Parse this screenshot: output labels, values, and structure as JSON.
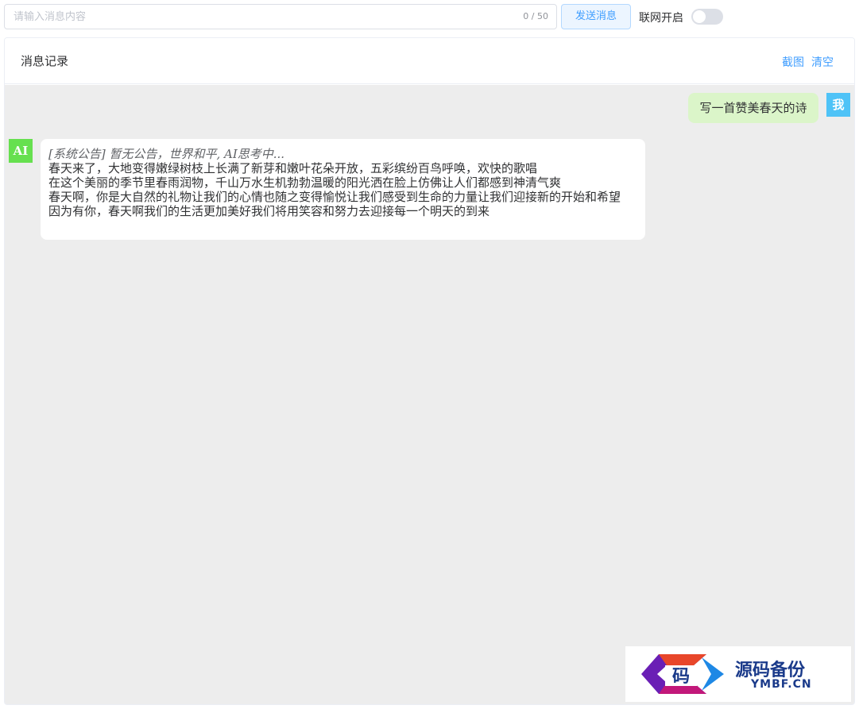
{
  "input": {
    "placeholder": "请输入消息内容",
    "value": "",
    "counter": "0 / 50"
  },
  "send_button": "发送消息",
  "network": {
    "label": "联网开启",
    "enabled": false
  },
  "panel": {
    "title": "消息记录",
    "screenshot_link": "截图",
    "clear_link": "清空"
  },
  "messages": {
    "user": {
      "avatar": "我",
      "text": "写一首赞美春天的诗"
    },
    "ai": {
      "avatar": "AI",
      "notice": "[系统公告] 暂无公告，世界和平, AI思考中...",
      "lines": [
        "春天来了，大地变得嫩绿树枝上长满了新芽和嫩叶花朵开放，五彩缤纷百鸟呼唤，欢快的歌唱",
        "在这个美丽的季节里春雨润物，千山万水生机勃勃温暖的阳光洒在脸上仿佛让人们都感到神清气爽",
        "春天啊，你是大自然的礼物让我们的心情也随之变得愉悦让我们感受到生命的力量让我们迎接新的开始和希望",
        "因为有你，春天啊我们的生活更加美好我们将用笑容和努力去迎接每一个明天的到来"
      ]
    }
  },
  "watermark": {
    "logo_char": "码",
    "title": "源码备份",
    "subtitle": "YMBF.CN"
  },
  "colors": {
    "accent": "#409eff",
    "user_bubble": "#dbf5c9",
    "ai_avatar": "#66e04f",
    "user_avatar": "#4fc3f7",
    "chat_bg": "#ededed"
  }
}
